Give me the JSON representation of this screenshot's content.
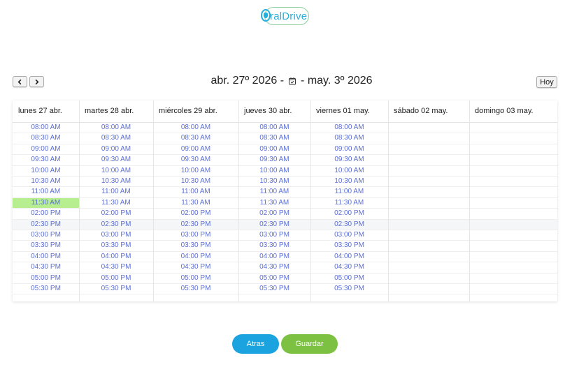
{
  "logo": {
    "text_o": "O",
    "text_rest": "ralDrive"
  },
  "colors": {
    "accent_blue": "#1aa3df",
    "accent_green": "#7dc142",
    "slot_text": "#5b6fd6",
    "selected_slot": "#b7ee8f"
  },
  "toolbar": {
    "prev_icon": "chevron-left-icon",
    "next_icon": "chevron-right-icon",
    "range_start": "abr. 27º 2026 -",
    "range_end": "- may. 3º 2026",
    "calendar_icon": "calendar-check-icon",
    "today_label": "Hoy"
  },
  "calendar": {
    "days": [
      {
        "label": "lunes 27 abr.",
        "slots": [
          "08:00 AM",
          "08:30 AM",
          "09:00 AM",
          "09:30 AM",
          "10:00 AM",
          "10:30 AM",
          "11:00 AM",
          "11:30 AM",
          "02:00 PM",
          "02:30 PM",
          "03:00 PM",
          "03:30 PM",
          "04:00 PM",
          "04:30 PM",
          "05:00 PM",
          "05:30 PM"
        ],
        "selected": "11:30 AM"
      },
      {
        "label": "martes 28 abr.",
        "slots": [
          "08:00 AM",
          "08:30 AM",
          "09:00 AM",
          "09:30 AM",
          "10:00 AM",
          "10:30 AM",
          "11:00 AM",
          "11:30 AM",
          "02:00 PM",
          "02:30 PM",
          "03:00 PM",
          "03:30 PM",
          "04:00 PM",
          "04:30 PM",
          "05:00 PM",
          "05:30 PM"
        ]
      },
      {
        "label": "miércoles 29 abr.",
        "slots": [
          "08:00 AM",
          "08:30 AM",
          "09:00 AM",
          "09:30 AM",
          "10:00 AM",
          "10:30 AM",
          "11:00 AM",
          "11:30 AM",
          "02:00 PM",
          "02:30 PM",
          "03:00 PM",
          "03:30 PM",
          "04:00 PM",
          "04:30 PM",
          "05:00 PM",
          "05:30 PM"
        ]
      },
      {
        "label": "jueves 30 abr.",
        "slots": [
          "08:00 AM",
          "08:30 AM",
          "09:00 AM",
          "09:30 AM",
          "10:00 AM",
          "10:30 AM",
          "11:00 AM",
          "11:30 AM",
          "02:00 PM",
          "02:30 PM",
          "03:00 PM",
          "03:30 PM",
          "04:00 PM",
          "04:30 PM",
          "05:00 PM",
          "05:30 PM"
        ]
      },
      {
        "label": "viernes 01 may.",
        "slots": [
          "08:00 AM",
          "08:30 AM",
          "09:00 AM",
          "09:30 AM",
          "10:00 AM",
          "10:30 AM",
          "11:00 AM",
          "11:30 AM",
          "02:00 PM",
          "02:30 PM",
          "03:00 PM",
          "03:30 PM",
          "04:00 PM",
          "04:30 PM",
          "05:00 PM",
          "05:30 PM"
        ]
      },
      {
        "label": "sábado 02 may.",
        "slots": []
      },
      {
        "label": "domingo 03 may.",
        "slots": []
      }
    ]
  },
  "actions": {
    "back_label": "Atras",
    "save_label": "Guardar"
  }
}
